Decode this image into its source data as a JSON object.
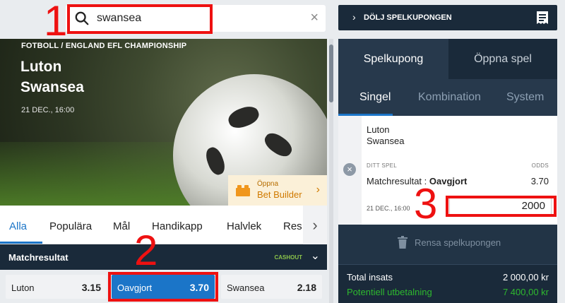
{
  "search": {
    "value": "swansea",
    "clear_glyph": "×"
  },
  "event": {
    "breadcrumb": "FOTBOLL / ENGLAND EFL CHAMPIONSHIP",
    "home_team": "Luton",
    "away_team": "Swansea",
    "date": "21 DEC., 16:00"
  },
  "bet_builder": {
    "small": "Öppna",
    "label": "Bet Builder",
    "icon": "lego-brick-icon"
  },
  "tabs": [
    {
      "label": "Alla"
    },
    {
      "label": "Populära"
    },
    {
      "label": "Mål"
    },
    {
      "label": "Handikapp"
    },
    {
      "label": "Halvlek"
    },
    {
      "label": "Res"
    }
  ],
  "market": {
    "title": "Matchresultat",
    "cashout": "CASHOUT",
    "outcomes": [
      {
        "label": "Luton",
        "odds": "3.15"
      },
      {
        "label": "Oavgjort",
        "odds": "3.70"
      },
      {
        "label": "Swansea",
        "odds": "2.18"
      }
    ]
  },
  "slip": {
    "toggle_label": "DÖLJ SPELKUPONGEN",
    "main_tabs": [
      "Spelkupong",
      "Öppna spel"
    ],
    "sub_tabs": [
      "Singel",
      "Kombination",
      "System"
    ],
    "bet": {
      "home": "Luton",
      "away": "Swansea",
      "your_bet_label": "DITT SPEL",
      "odds_label": "ODDS",
      "market_prefix": "Matchresultat : ",
      "selection": "Oavgjort",
      "odds": "3.70",
      "date": "21 DEC., 16:00",
      "stake": "2000"
    },
    "clear_label": "Rensa spelkupongen",
    "total_stake_label": "Total insats",
    "total_stake_value": "2 000,00 kr",
    "potential_label": "Potentiell utbetalning",
    "potential_value": "7 400,00 kr"
  },
  "annotations": [
    "1",
    "2",
    "3"
  ],
  "colors": {
    "accent": "#1b75c8",
    "annotation": "#ee1111",
    "positive": "#2eb82e",
    "navy": "#1a2a3a"
  }
}
